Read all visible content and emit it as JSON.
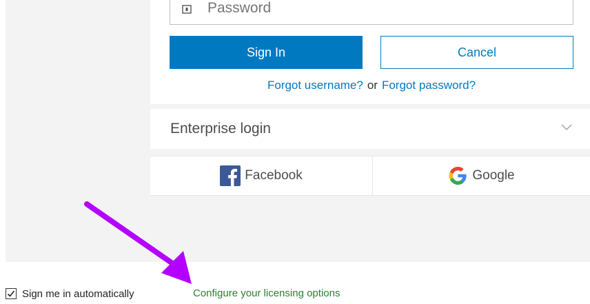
{
  "login": {
    "password_placeholder": "Password",
    "signin_label": "Sign In",
    "cancel_label": "Cancel",
    "forgot_username": "Forgot username?",
    "or_text": "or",
    "forgot_password": "Forgot password?"
  },
  "enterprise": {
    "label": "Enterprise login",
    "icon": "chevron-down-icon"
  },
  "social": {
    "facebook_label": "Facebook",
    "google_label": "Google"
  },
  "footer": {
    "auto_signin_label": "Sign me in automatically",
    "auto_signin_checked": true,
    "licensing_link": "Configure your licensing options"
  },
  "colors": {
    "primary": "#0079c1",
    "annotation_arrow": "#b400ff",
    "licensing_link": "#2e7d32"
  }
}
